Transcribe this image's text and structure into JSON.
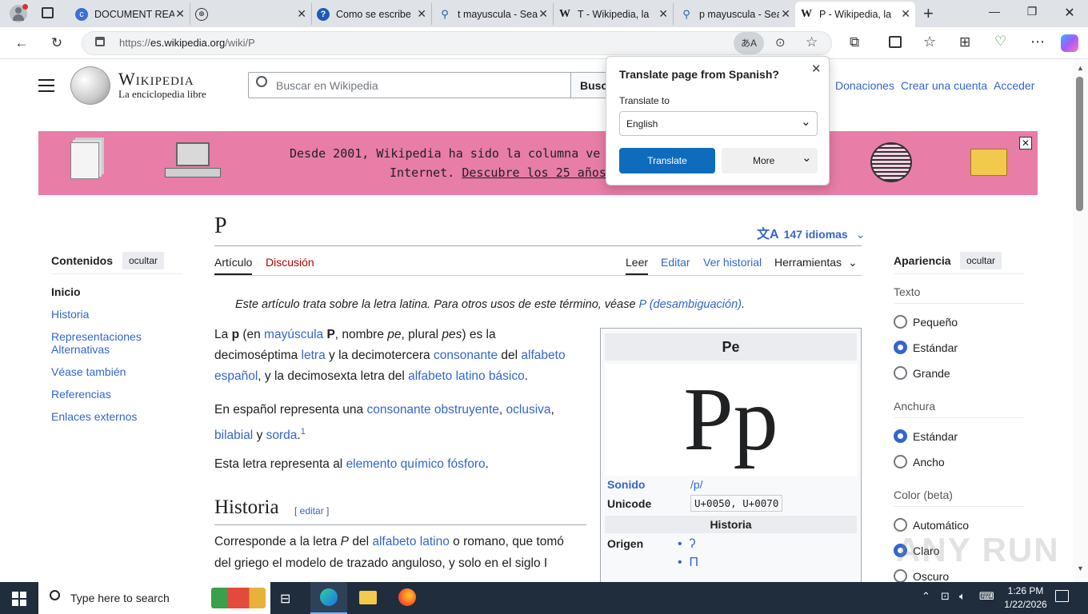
{
  "browser": {
    "tabs": [
      {
        "title": "DOCUMENT REA",
        "icon": "c-logo-icon"
      },
      {
        "title": "",
        "icon": "globe-icon"
      },
      {
        "title": "Como se escribe",
        "icon": "help-icon"
      },
      {
        "title": "t mayuscula - Sea",
        "icon": "search-icon"
      },
      {
        "title": "T - Wikipedia, la",
        "icon": "wikipedia-icon"
      },
      {
        "title": "p mayuscula - Sea",
        "icon": "search-icon"
      },
      {
        "title": "P - Wikipedia, la",
        "icon": "wikipedia-icon"
      }
    ],
    "url_prefix": "https://",
    "url_host": "es.wikipedia.org",
    "url_path": "/wiki/P"
  },
  "translate": {
    "title": "Translate page from Spanish?",
    "label": "Translate to",
    "language": "English",
    "translate_btn": "Translate",
    "more_btn": "More"
  },
  "wiki": {
    "logo_title": "Wikipedia",
    "logo_sub": "La enciclopedia libre",
    "search_placeholder": "Buscar en Wikipedia",
    "search_btn": "Busc",
    "nav": [
      "Donaciones",
      "Crear una cuenta",
      "Acceder"
    ],
    "banner_line1": "Desde 2001, Wikipedia ha sido la columna ve",
    "banner_line2a": "Internet. ",
    "banner_line2b": "Descubre los 25 años",
    "title": "P",
    "languages": "147 idiomas",
    "tab_article": "Artículo",
    "tab_talk": "Discusión",
    "tab_read": "Leer",
    "tab_edit": "Editar",
    "tab_history": "Ver historial",
    "tab_tools": "Herramientas",
    "toc_title": "Contenidos",
    "toc_hide": "ocultar",
    "toc_items": [
      "Inicio",
      "Historia",
      "Representaciones",
      "Alternativas",
      "Véase también",
      "Referencias",
      "Enlaces externos"
    ],
    "hatnote_a": "Este artículo trata sobre la letra latina. Para otros usos de este término, véase ",
    "hatnote_link": "P (desambiguación)",
    "hatnote_end": ".",
    "p1": [
      "La ",
      "p",
      " (en ",
      "mayúscula",
      " ",
      "P",
      ", nombre ",
      "pe",
      ", plural ",
      "pes",
      ") es la"
    ],
    "p1_line2": [
      "decimoséptima ",
      "letra",
      " y la decimotercera ",
      "consonante",
      " del ",
      "alfabeto"
    ],
    "p1_line3": [
      "español",
      ", y la decimosexta letra del ",
      "alfabeto latino básico",
      "."
    ],
    "p2_line1": [
      "En español representa una ",
      "consonante obstruyente",
      ", ",
      "oclusiva",
      ","
    ],
    "p2_line2": [
      "bilabial",
      " y ",
      "sorda",
      ".",
      "1"
    ],
    "p3": [
      "Esta letra representa al ",
      "elemento químico fósforo",
      "."
    ],
    "h2": "Historia",
    "h2_edit": "editar",
    "p4_line1": [
      "Corresponde a la letra ",
      "P",
      " del ",
      "alfabeto latino",
      " o romano, que tomó"
    ],
    "p4_line2": "del griego el modelo de trazado anguloso, y solo en el siglo I",
    "infobox_title": "Pe",
    "infobox_glyph": "Pp",
    "infobox_sound_label": "Sonido",
    "infobox_sound_value": "/p/",
    "infobox_unicode_label": "Unicode",
    "infobox_unicode_value": "U+0050, U+0070",
    "infobox_history": "Historia",
    "infobox_origin_label": "Origen",
    "infobox_origin_items": [
      "ʔ",
      "П"
    ],
    "appearance_title": "Apariencia",
    "appearance_hide": "ocultar",
    "text_label": "Texto",
    "text_options": [
      "Pequeño",
      "Estándar",
      "Grande"
    ],
    "width_label": "Anchura",
    "width_options": [
      "Estándar",
      "Ancho"
    ],
    "color_label": "Color (beta)",
    "color_options": [
      "Automático",
      "Claro",
      "Oscuro"
    ]
  },
  "taskbar": {
    "search_placeholder": "Type here to search",
    "time": "1:26 PM",
    "date": "1/22/2026"
  },
  "watermark": "ANY RUN"
}
